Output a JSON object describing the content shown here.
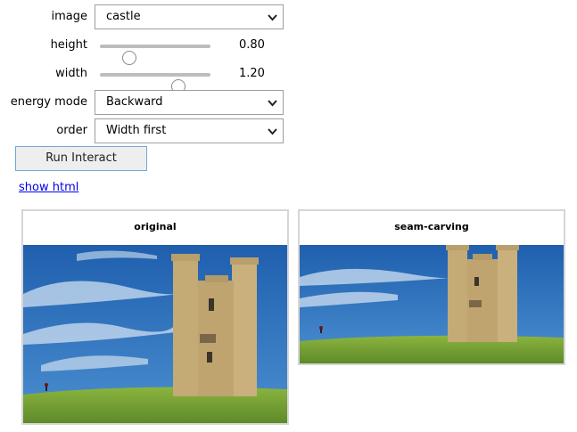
{
  "controls": {
    "image": {
      "label": "image",
      "value": "castle"
    },
    "height": {
      "label": "height",
      "value": 0.8,
      "display": "0.80",
      "fraction": 0.27
    },
    "width": {
      "label": "width",
      "value": 1.2,
      "display": "1.20",
      "fraction": 0.71
    },
    "energy_mode": {
      "label": "energy mode",
      "value": "Backward"
    },
    "order": {
      "label": "order",
      "value": "Width first"
    }
  },
  "run_button": {
    "label": "Run Interact"
  },
  "show_html_link": "show html",
  "panels": [
    {
      "title": "original"
    },
    {
      "title": "seam-carving"
    }
  ],
  "colors": {
    "sky": "#2e70b8",
    "grass": "#76a83a",
    "stone": "#c9b07c",
    "button_border": "#6fa8dc",
    "link": "#0000ee"
  }
}
